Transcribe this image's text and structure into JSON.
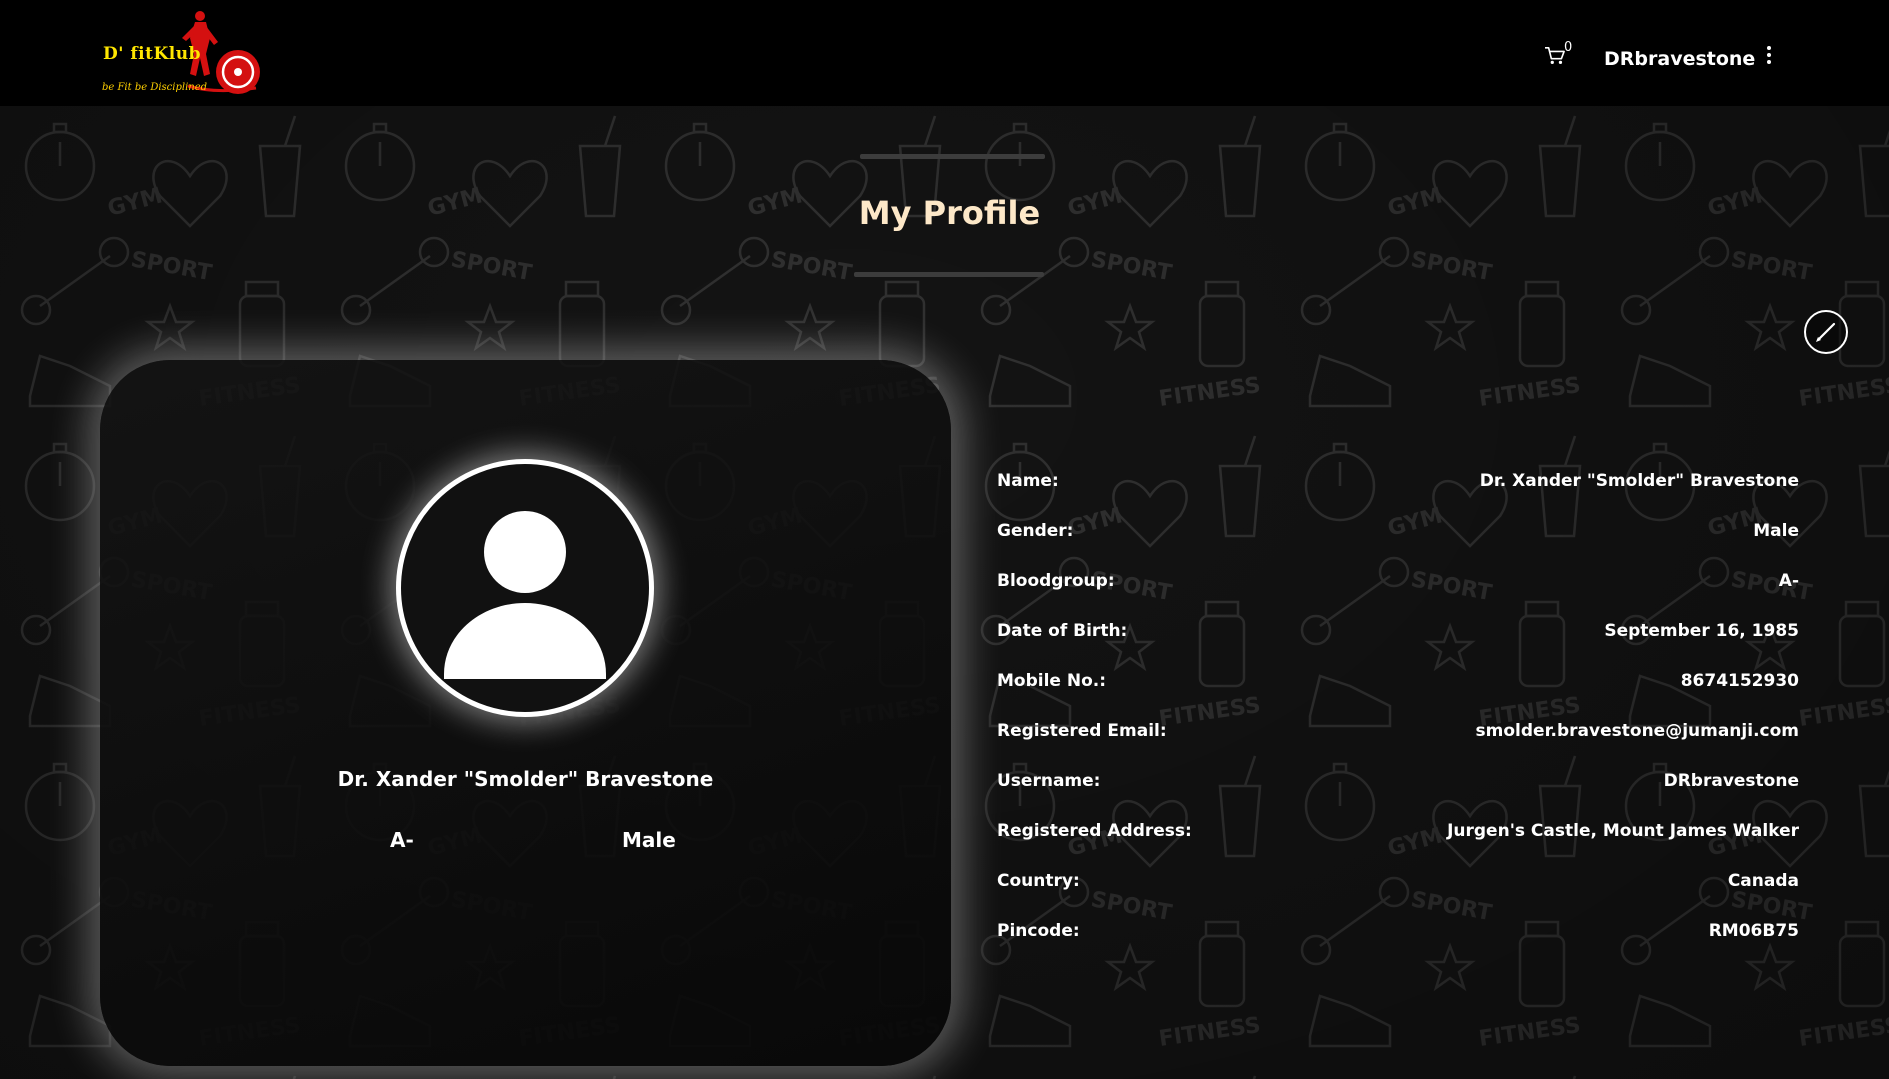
{
  "header": {
    "logo_title": "D' fitKlub",
    "logo_tagline": "be Fit be Disciplined",
    "cart_count": "0",
    "username": "DRbravestone"
  },
  "main": {
    "page_title": "My Profile",
    "card": {
      "name": "Dr. Xander \"Smolder\" Bravestone",
      "bloodgroup": "A-",
      "gender": "Male"
    },
    "details": [
      {
        "label": "Name:",
        "value": "Dr. Xander \"Smolder\" Bravestone"
      },
      {
        "label": "Gender:",
        "value": "Male"
      },
      {
        "label": "Bloodgroup:",
        "value": "A-"
      },
      {
        "label": "Date of Birth:",
        "value": "September 16, 1985"
      },
      {
        "label": "Mobile No.:",
        "value": "8674152930"
      },
      {
        "label": "Registered Email:",
        "value": "smolder.bravestone@jumanji.com"
      },
      {
        "label": "Username:",
        "value": "DRbravestone"
      },
      {
        "label": "Registered Address:",
        "value": "Jurgen's Castle, Mount James Walker"
      },
      {
        "label": "Country:",
        "value": "Canada"
      },
      {
        "label": "Pincode:",
        "value": "RM06B75"
      }
    ]
  },
  "icons": {
    "cart": "shopping-cart-icon",
    "menu": "kebab-menu-icon",
    "edit": "pencil-icon",
    "avatar": "user-silhouette-icon"
  },
  "colors": {
    "background": "#000000",
    "title": "#fde8c8",
    "logo_yellow": "#ffe600",
    "logo_red": "#e01010"
  }
}
